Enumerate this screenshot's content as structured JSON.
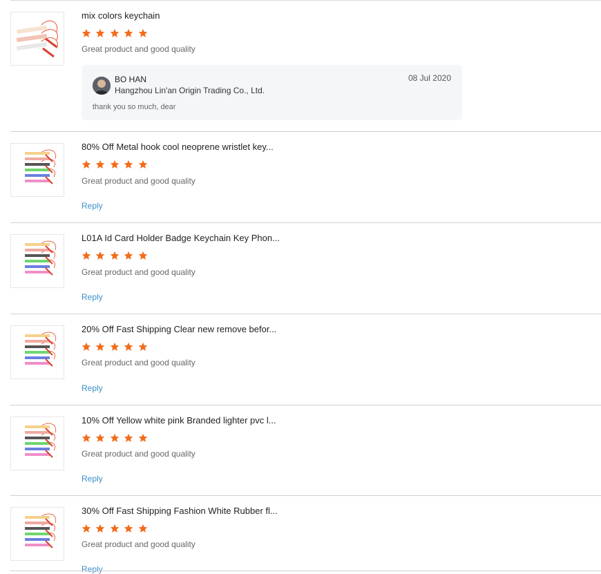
{
  "reviews": [
    {
      "title": "mix colors keychain",
      "rating": 5,
      "comment": "Great product and good quality",
      "seller_reply": {
        "name": "BO HAN",
        "company": "Hangzhou Lin'an Origin Trading Co., Ltd.",
        "date": "08 Jul 2020",
        "message": "thank you so much, dear"
      }
    },
    {
      "title": "80% Off Metal hook cool neoprene wristlet key...",
      "rating": 5,
      "comment": "Great product and good quality",
      "reply_label": "Reply"
    },
    {
      "title": "L01A Id Card Holder Badge Keychain Key Phon...",
      "rating": 5,
      "comment": "Great product and good quality",
      "reply_label": "Reply"
    },
    {
      "title": "20% Off Fast Shipping Clear new remove befor...",
      "rating": 5,
      "comment": "Great product and good quality",
      "reply_label": "Reply"
    },
    {
      "title": "10% Off Yellow white pink Branded lighter pvc l...",
      "rating": 5,
      "comment": "Great product and good quality",
      "reply_label": "Reply"
    },
    {
      "title": "30% Off Fast Shipping Fashion White Rubber fl...",
      "rating": 5,
      "comment": "Great product and good quality",
      "reply_label": "Reply"
    }
  ],
  "colors": {
    "star": "#f26c1b",
    "link": "#3a8fc7"
  },
  "icons": {
    "star": "star-icon",
    "avatar": "avatar"
  }
}
